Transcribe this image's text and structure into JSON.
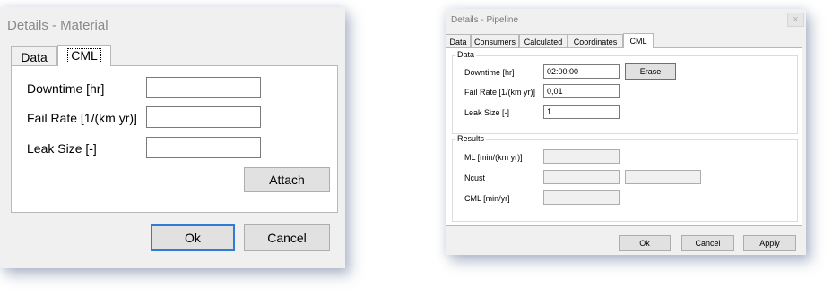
{
  "material": {
    "title": "Details - Material",
    "tabs": [
      {
        "label": "Data"
      },
      {
        "label": "CML"
      }
    ],
    "fields": [
      {
        "label": "Downtime [hr]",
        "value": ""
      },
      {
        "label": "Fail Rate [1/(km yr)]",
        "value": ""
      },
      {
        "label": "Leak Size [-]",
        "value": ""
      }
    ],
    "attach_label": "Attach",
    "ok_label": "Ok",
    "cancel_label": "Cancel"
  },
  "pipeline": {
    "title": "Details - Pipeline",
    "close_glyph": "×",
    "tabs": [
      {
        "label": "Data"
      },
      {
        "label": "Consumers"
      },
      {
        "label": "Calculated"
      },
      {
        "label": "Coordinates"
      },
      {
        "label": "CML"
      }
    ],
    "data_group": {
      "title": "Data",
      "fields": [
        {
          "label": "Downtime [hr]",
          "value": "02:00:00"
        },
        {
          "label": "Fail Rate [1/(km yr)]",
          "value": "0,01"
        },
        {
          "label": "Leak Size [-]",
          "value": "1"
        }
      ],
      "erase_label": "Erase"
    },
    "results_group": {
      "title": "Results",
      "fields": [
        {
          "label": "ML [min/(km yr)]",
          "value": ""
        },
        {
          "label": "Ncust",
          "value": "",
          "value2": ""
        },
        {
          "label": "CML [min/yr]",
          "value": ""
        }
      ]
    },
    "ok_label": "Ok",
    "cancel_label": "Cancel",
    "apply_label": "Apply"
  }
}
